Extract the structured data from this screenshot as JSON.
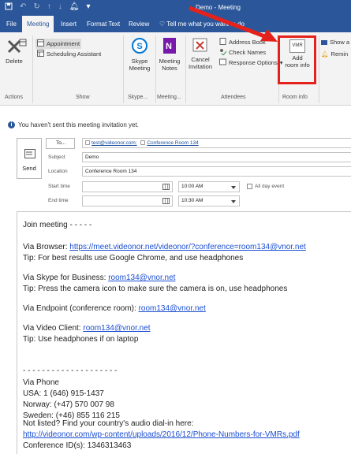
{
  "title_bar": {
    "window_title": "Demo - Meeting",
    "quick_access": [
      "save-icon",
      "undo-icon",
      "redo-icon",
      "up-icon",
      "down-icon",
      "bell-icon",
      "more-icon"
    ]
  },
  "tabs": [
    {
      "label": "File"
    },
    {
      "label": "Meeting"
    },
    {
      "label": "Insert"
    },
    {
      "label": "Format Text"
    },
    {
      "label": "Review"
    },
    {
      "label": "Tell me what you want to do"
    }
  ],
  "ribbon": {
    "actions": {
      "delete": "Delete",
      "group": "Actions"
    },
    "show": {
      "appointment": "Appointment",
      "scheduling": "Scheduling Assistant",
      "group": "Show"
    },
    "skype": {
      "label1": "Skype",
      "label2": "Meeting",
      "group": "Skype..."
    },
    "meeting_notes": {
      "label1": "Meeting",
      "label2": "Notes",
      "group": "Meeting..."
    },
    "attendees": {
      "cancel1": "Cancel",
      "cancel2": "Invitation",
      "address_book": "Address Book",
      "check_names": "Check Names",
      "response_options": "Response Options",
      "group": "Attendees"
    },
    "room_info": {
      "icon_text": "VMR",
      "label1": "Add",
      "label2": "room info",
      "group": "Room info"
    },
    "show_as": "Show a",
    "reminder": "Remin"
  },
  "info_bar": "You haven't sent this meeting invitation yet.",
  "form": {
    "send": "Send",
    "to_button": "To...",
    "recipients": [
      "test@videonor.com;",
      "Conference Room 134"
    ],
    "subject_label": "Subject",
    "subject_value": "Demo",
    "location_label": "Location",
    "location_value": "Conference Room 134",
    "start_label": "Start time",
    "end_label": "End time",
    "start_time": "10:00 AM",
    "end_time": "10:30 AM",
    "all_day": "All day event"
  },
  "body": {
    "join": "Join meeting - - - - -",
    "browser_prefix": "Via Browser: ",
    "browser_link": "https://meet.videonor.net/videonor/?conference=room134@vnor.net",
    "browser_tip": "Tip: For best results use Google Chrome, and use headphones",
    "skype_prefix": "Via Skype for Business: ",
    "skype_link": "room134@vnor.net",
    "skype_tip": "Tip: Press the camera icon to make sure the camera is on, use headphones",
    "endpoint_prefix": "Via Endpoint (conference room): ",
    "endpoint_link": "room134@vnor.net",
    "client_prefix": "Via Video Client: ",
    "client_link": "room134@vnor.net",
    "client_tip": "Tip: Use headphones if on laptop",
    "divider": "- - - - - - - - - - - - - - - - - - - -",
    "phone_heading": "Via Phone",
    "phone_usa": "USA: 1 (646) 915-1437",
    "phone_norway": "Norway:  (+47) 570 007 98",
    "phone_sweden": "Sweden: (+46) 855 116 215",
    "not_listed": "Not listed? Find your country's audio dial-in here:",
    "dialin_link": "http://videonor.com/wp-content/uploads/2016/12/Phone-Numbers-for-VMRs.pdf",
    "conference_id": "Conference ID(s): 1346313463"
  },
  "colors": {
    "brand": "#2b579a",
    "highlight": "#e5211c",
    "link": "#1a4dd1"
  }
}
